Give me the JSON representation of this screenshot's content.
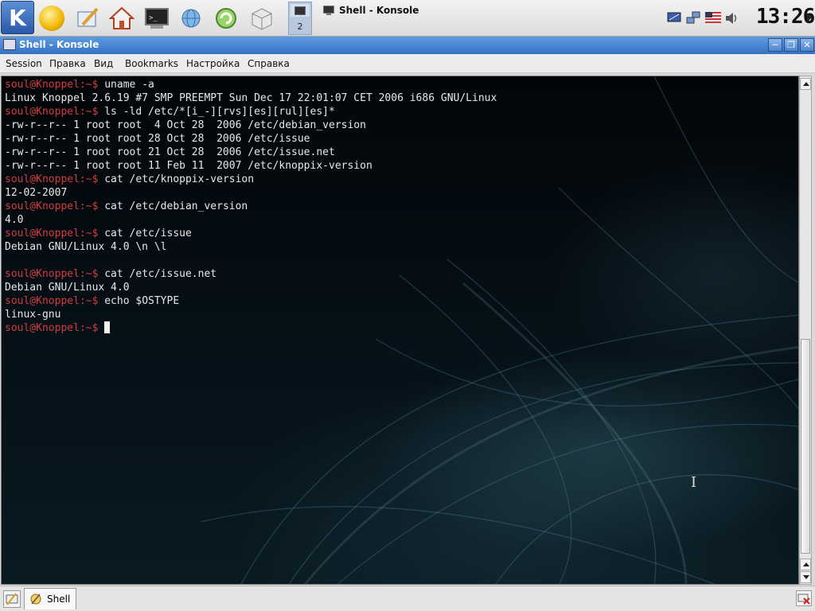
{
  "panel": {
    "launchers": [
      "kde-menu",
      "knoppix-penguin",
      "text-editor",
      "home-folder",
      "konsole",
      "network",
      "update",
      "package-manager"
    ],
    "pager": {
      "active_desktop": "2"
    },
    "task": {
      "title": "Shell - Konsole"
    },
    "tray_icons": [
      "display-icon",
      "network-icon",
      "us-flag-keyboard-icon",
      "volume-icon"
    ],
    "clock": "13:26"
  },
  "window": {
    "title": "Shell - Konsole",
    "buttons": [
      "minimize",
      "maximize",
      "close"
    ]
  },
  "menubar": {
    "items": [
      "Session",
      "Правка",
      "Вид",
      "Bookmarks",
      "Настройка",
      "Справка"
    ]
  },
  "terminal": {
    "colors": {
      "prompt": "#d43c3c",
      "text": "#e8e8e8",
      "background": "#04090d"
    },
    "lines": [
      {
        "prompt": "soul@Knoppel:~$",
        "text": " uname -a"
      },
      {
        "prompt": "",
        "text": "Linux Knoppel 2.6.19 #7 SMP PREEMPT Sun Dec 17 22:01:07 CET 2006 i686 GNU/Linux"
      },
      {
        "prompt": "soul@Knoppel:~$",
        "text": " ls -ld /etc/*[i_-][rvs][es][rul][es]*"
      },
      {
        "prompt": "",
        "text": "-rw-r--r-- 1 root root  4 Oct 28  2006 /etc/debian_version"
      },
      {
        "prompt": "",
        "text": "-rw-r--r-- 1 root root 28 Oct 28  2006 /etc/issue"
      },
      {
        "prompt": "",
        "text": "-rw-r--r-- 1 root root 21 Oct 28  2006 /etc/issue.net"
      },
      {
        "prompt": "",
        "text": "-rw-r--r-- 1 root root 11 Feb 11  2007 /etc/knoppix-version"
      },
      {
        "prompt": "soul@Knoppel:~$",
        "text": " cat /etc/knoppix-version"
      },
      {
        "prompt": "",
        "text": "12-02-2007"
      },
      {
        "prompt": "soul@Knoppel:~$",
        "text": " cat /etc/debian_version"
      },
      {
        "prompt": "",
        "text": "4.0"
      },
      {
        "prompt": "soul@Knoppel:~$",
        "text": " cat /etc/issue"
      },
      {
        "prompt": "",
        "text": "Debian GNU/Linux 4.0 \\n \\l"
      },
      {
        "prompt": "",
        "text": ""
      },
      {
        "prompt": "soul@Knoppel:~$",
        "text": " cat /etc/issue.net"
      },
      {
        "prompt": "",
        "text": "Debian GNU/Linux 4.0"
      },
      {
        "prompt": "soul@Knoppel:~$",
        "text": " echo $OSTYPE"
      },
      {
        "prompt": "",
        "text": "linux-gnu"
      },
      {
        "prompt": "soul@Knoppel:~$",
        "text": " ",
        "cursor": true
      }
    ]
  },
  "tabs": {
    "items": [
      {
        "label": "Shell"
      }
    ]
  }
}
